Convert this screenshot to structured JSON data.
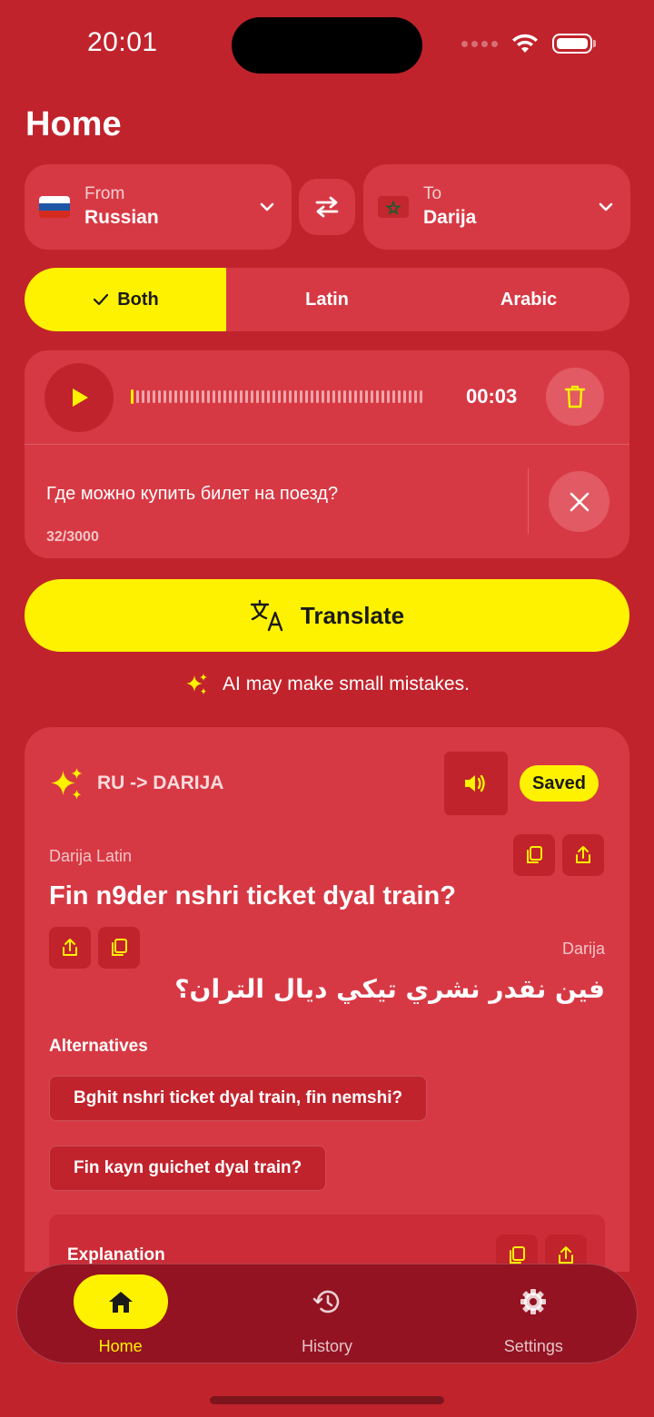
{
  "status_bar": {
    "time": "20:01"
  },
  "header": {
    "title": "Home"
  },
  "language": {
    "from_label": "From",
    "from_value": "Russian",
    "to_label": "To",
    "to_value": "Darija",
    "from_flag_icon": "russia-flag-icon",
    "to_flag_icon": "morocco-flag-icon"
  },
  "script_toggle": {
    "options": [
      "Both",
      "Latin",
      "Arabic"
    ],
    "selected": "Both"
  },
  "input": {
    "recording_time": "00:03",
    "text": "Где можно купить билет на поезд?",
    "char_count": "32/3000"
  },
  "translate_button": {
    "label": "Translate"
  },
  "disclaimer": "AI may make small mistakes.",
  "result": {
    "direction": "RU -> DARIJA",
    "saved_label": "Saved",
    "latin_label": "Darija Latin",
    "latin_text": "Fin n9der nshri ticket dyal train?",
    "arabic_label": "Darija",
    "arabic_text": "فين نقدر نشري تيكي ديال التران؟",
    "alternatives_title": "Alternatives",
    "alternatives": [
      "Bghit nshri ticket dyal train, fin nemshi?",
      "Fin kayn guichet dyal train?"
    ],
    "explanation_title": "Explanation"
  },
  "tabbar": {
    "tabs": [
      {
        "label": "Home",
        "icon": "home-icon",
        "active": true
      },
      {
        "label": "History",
        "icon": "history-icon",
        "active": false
      },
      {
        "label": "Settings",
        "icon": "settings-icon",
        "active": false
      }
    ]
  },
  "colors": {
    "background": "#c1232c",
    "card": "#d73944",
    "accent": "#fff200",
    "tabbar": "#931322"
  }
}
